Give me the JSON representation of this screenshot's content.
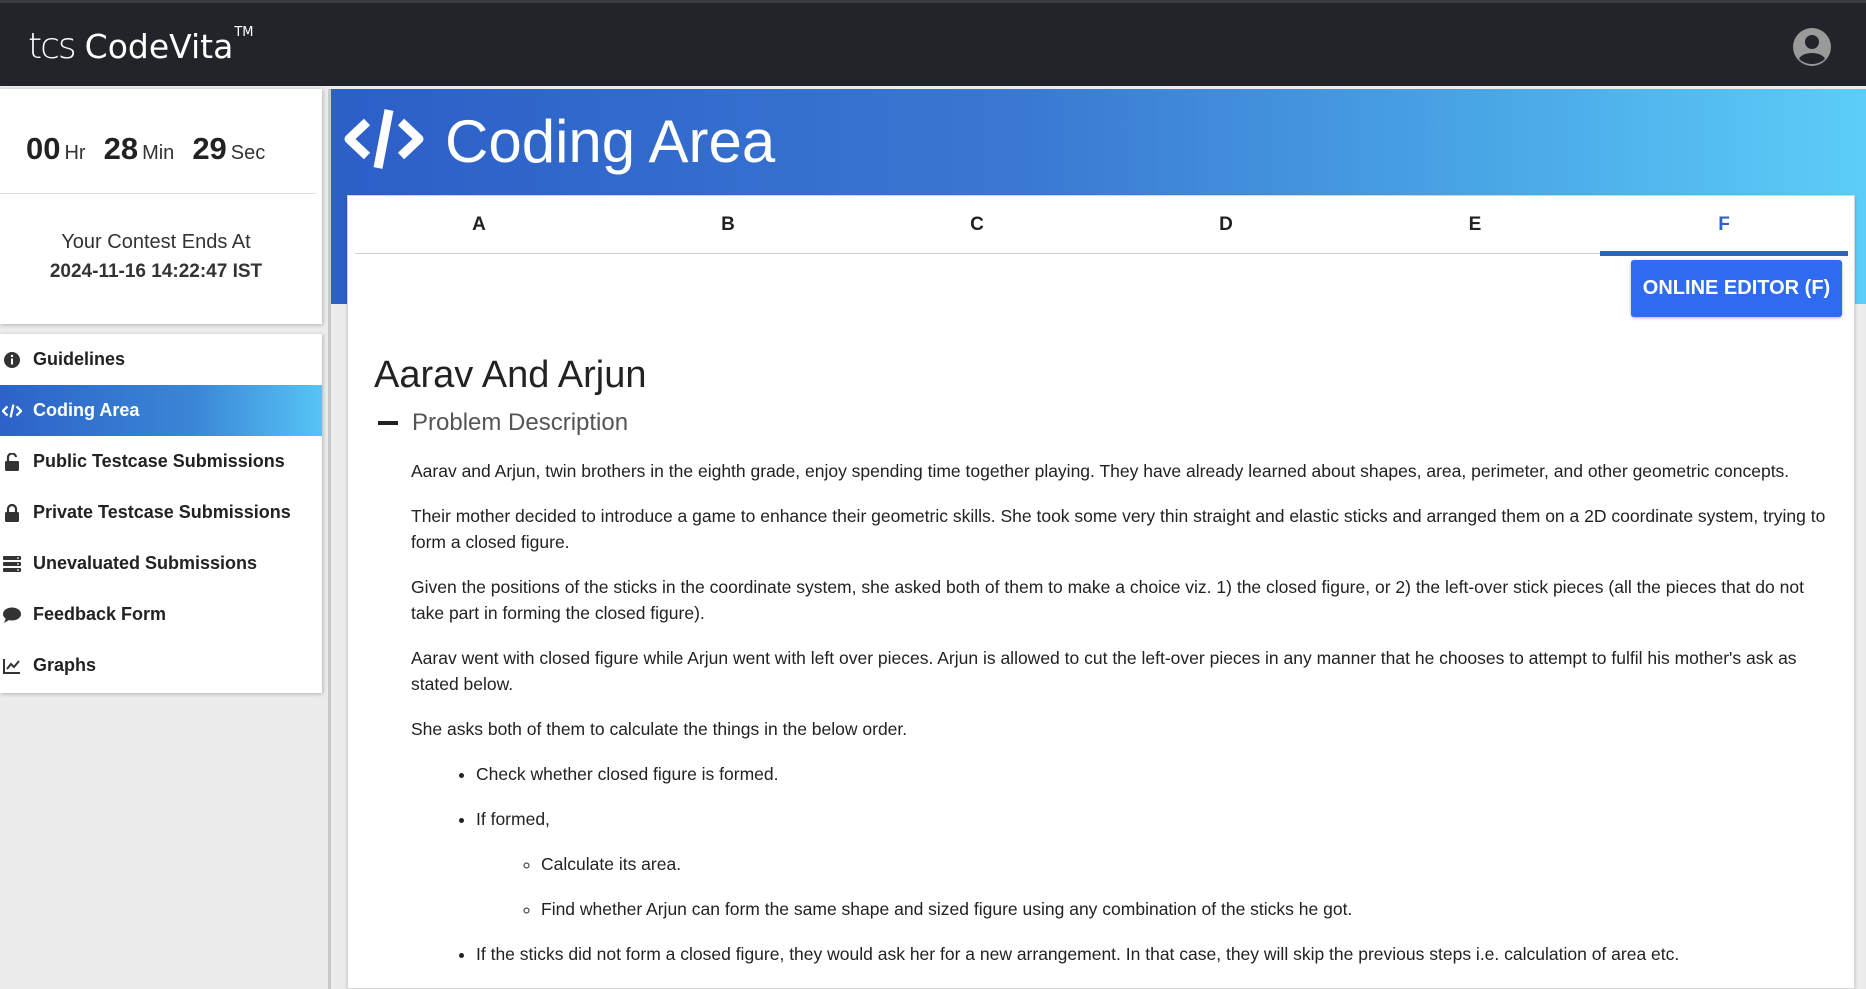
{
  "brand": {
    "logo_mark": "tcs",
    "name": "CodeVita",
    "trademark": "TM"
  },
  "timer": {
    "hours": "00",
    "hours_unit": "Hr",
    "minutes": "28",
    "minutes_unit": "Min",
    "seconds": "29",
    "seconds_unit": "Sec"
  },
  "contest": {
    "ends_label": "Your Contest Ends At",
    "ends_time": "2024-11-16 14:22:47 IST"
  },
  "sidebar": {
    "items": [
      {
        "label": "Guidelines",
        "icon": "info-circle-icon",
        "active": false
      },
      {
        "label": "Coding Area",
        "icon": "code-icon",
        "active": true
      },
      {
        "label": "Public Testcase Submissions",
        "icon": "unlock-icon",
        "active": false
      },
      {
        "label": "Private Testcase Submissions",
        "icon": "lock-icon",
        "active": false
      },
      {
        "label": "Unevaluated Submissions",
        "icon": "server-icon",
        "active": false
      },
      {
        "label": "Feedback Form",
        "icon": "comment-icon",
        "active": false
      },
      {
        "label": "Graphs",
        "icon": "chart-line-icon",
        "active": false
      }
    ]
  },
  "header": {
    "title": "Coding Area",
    "icon": "code-icon"
  },
  "tabs": [
    {
      "label": "A",
      "active": false
    },
    {
      "label": "B",
      "active": false
    },
    {
      "label": "C",
      "active": false
    },
    {
      "label": "D",
      "active": false
    },
    {
      "label": "E",
      "active": false
    },
    {
      "label": "F",
      "active": true
    }
  ],
  "editor_button": {
    "label": "ONLINE EDITOR (F)"
  },
  "problem": {
    "title": "Aarav And Arjun",
    "section_label": "Problem Description",
    "paragraphs": [
      "Aarav and Arjun, twin brothers in the eighth grade, enjoy spending time together playing. They have already learned about shapes, area, perimeter, and other geometric concepts.",
      "Their mother decided to introduce a game to enhance their geometric skills. She took some very thin straight and elastic sticks and arranged them on a 2D coordinate system, trying to form a closed figure.",
      "Given the positions of the sticks in the coordinate system, she asked both of them to make a choice viz. 1) the closed figure, or 2) the left-over stick pieces (all the pieces that do not take part in forming the closed figure).",
      "Aarav went with closed figure while Arjun went with left over pieces. Arjun is allowed to cut the left-over pieces in any manner that he chooses to attempt to fulfil his mother's ask as stated below.",
      "She asks both of them to calculate the things in the below order."
    ],
    "bullets": {
      "b1": "Check whether closed figure is formed.",
      "b2": "If formed,",
      "b2_sub1": "Calculate its area.",
      "b2_sub2": "Find whether Arjun can form the same shape and sized figure using any combination of the sticks he got.",
      "b3": "If the sticks did not form a closed figure, they would ask her for a new arrangement. In that case, they will skip the previous steps i.e. calculation of area etc."
    }
  },
  "colors": {
    "accent": "#2d62c8",
    "topbar": "#212529",
    "button": "#2f6bf0"
  }
}
